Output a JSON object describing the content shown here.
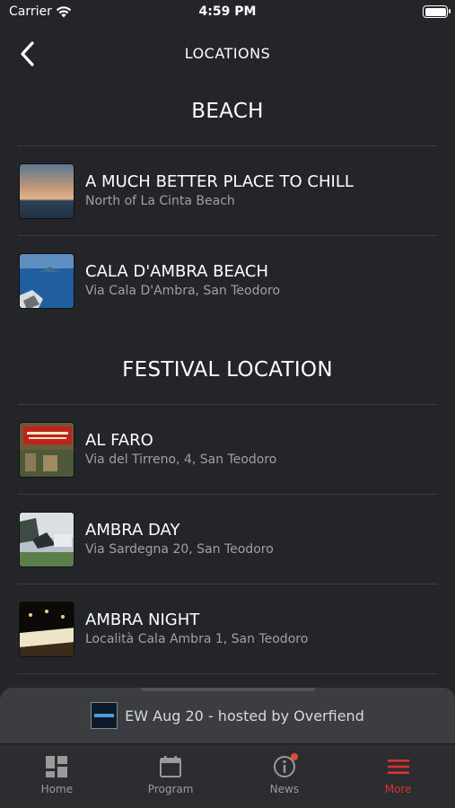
{
  "status": {
    "carrier": "Carrier",
    "time": "4:59 PM"
  },
  "header": {
    "title": "LOCATIONS"
  },
  "sections": [
    {
      "title": "BEACH",
      "items": [
        {
          "title": "A MUCH BETTER PLACE TO CHILL",
          "subtitle": "North of La Cinta Beach"
        },
        {
          "title": "CALA D'AMBRA BEACH",
          "subtitle": "Via Cala D'Ambra, San Teodoro"
        }
      ]
    },
    {
      "title": "FESTIVAL LOCATION",
      "items": [
        {
          "title": "AL FARO",
          "subtitle": "Via del Tirreno, 4, San Teodoro"
        },
        {
          "title": "AMBRA DAY",
          "subtitle": "Via Sardegna 20, San Teodoro"
        },
        {
          "title": "AMBRA NIGHT",
          "subtitle": "Località Cala Ambra 1, San Teodoro"
        }
      ]
    }
  ],
  "player": {
    "label": "EW Aug 20 - hosted by Overfiend"
  },
  "tabs": [
    {
      "label": "Home",
      "icon": "grid-icon"
    },
    {
      "label": "Program",
      "icon": "calendar-icon"
    },
    {
      "label": "News",
      "icon": "info-icon"
    },
    {
      "label": "More",
      "icon": "menu-icon"
    }
  ],
  "colors": {
    "background": "#232528",
    "accent": "#d9342b"
  }
}
